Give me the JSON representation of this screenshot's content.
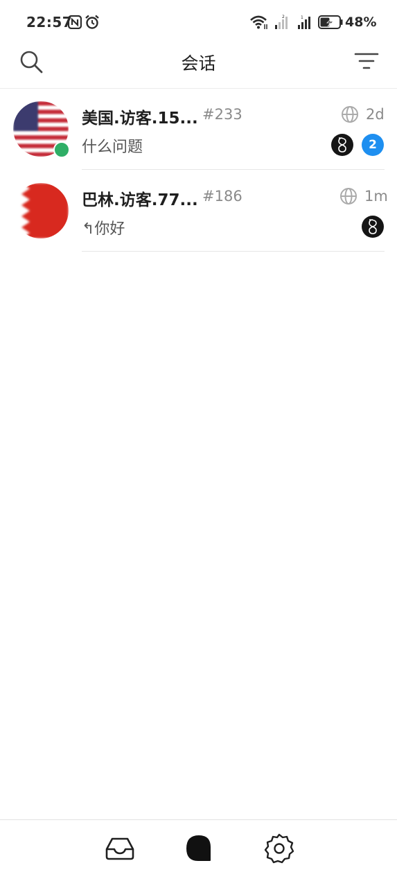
{
  "status_bar": {
    "time": "22:57",
    "battery_percent": "48%",
    "icons": [
      "nfc-icon",
      "alarm-icon",
      "wifi-icon",
      "signal-icon",
      "signal-icon",
      "battery-charging-icon"
    ]
  },
  "header": {
    "title": "会话",
    "icons": [
      "search-icon",
      "filter-icon"
    ]
  },
  "conversations": [
    {
      "name": "美国.访客.15...",
      "number": "#233",
      "time": "2d",
      "preview": "什么问题",
      "unread": "2",
      "online": true,
      "flag": "us-flag-icon"
    },
    {
      "name": "巴林.访客.77...",
      "number": "#186",
      "time": "1m",
      "preview": "↰你好",
      "unread": "",
      "online": false,
      "flag": "bahrain-flag-icon"
    }
  ],
  "colors": {
    "unread_badge": "#1e8ff0",
    "online_dot": "#2fae66",
    "muted_text": "#8a8a8a"
  },
  "bottom_nav": {
    "items": [
      "inbox-icon",
      "chat-bubble-icon",
      "settings-icon"
    ],
    "active": "chat-bubble-icon"
  }
}
